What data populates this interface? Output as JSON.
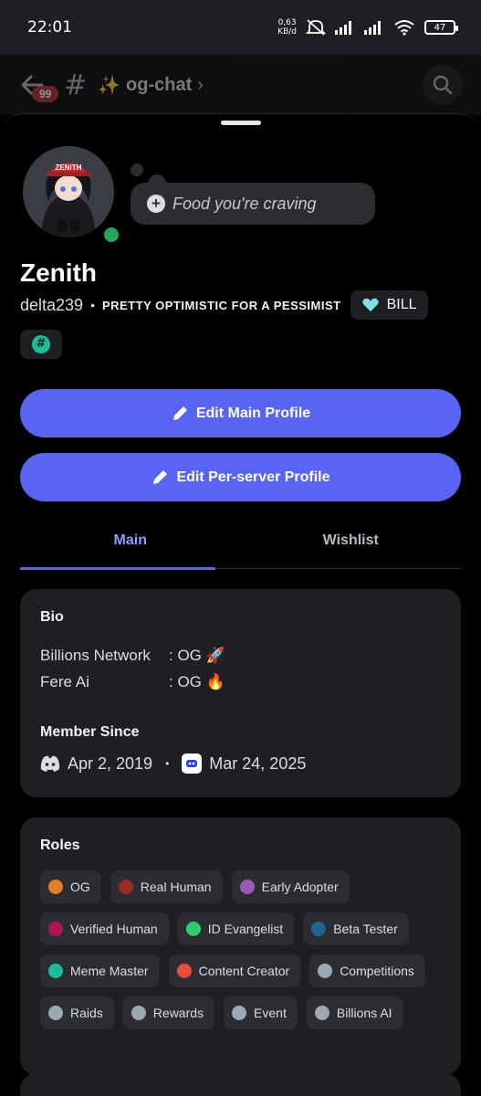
{
  "status_bar": {
    "time": "22:01",
    "net_speed_value": "0,63",
    "net_speed_unit": "KB/d",
    "battery": "47"
  },
  "channel_header": {
    "unread_badge": "99",
    "channel_name": "og-chat"
  },
  "profile": {
    "custom_status_placeholder": "Food you're craving",
    "display_name": "Zenith",
    "username": "delta239",
    "pronouns": "PRETTY OPTIMISTIC FOR A PESSIMIST",
    "clan_tag": "BILL",
    "avatar_cap_text": "ZENITH"
  },
  "buttons": {
    "edit_main": "Edit Main Profile",
    "edit_server": "Edit Per-server Profile"
  },
  "tabs": [
    {
      "label": "Main",
      "active": true
    },
    {
      "label": "Wishlist",
      "active": false
    }
  ],
  "bio": {
    "title": "Bio",
    "lines": [
      {
        "key": "Billions Network",
        "value": ": OG 🚀"
      },
      {
        "key": "Fere Ai",
        "value": ": OG 🔥"
      }
    ]
  },
  "member_since": {
    "title": "Member Since",
    "discord_date": "Apr 2, 2019",
    "server_date": "Mar 24, 2025"
  },
  "roles": {
    "title": "Roles",
    "items": [
      {
        "label": "OG",
        "color": "#e67e22"
      },
      {
        "label": "Real Human",
        "color": "#992d22"
      },
      {
        "label": "Early Adopter",
        "color": "#9b59b6"
      },
      {
        "label": "Verified Human",
        "color": "#ad1457"
      },
      {
        "label": "ID Evangelist",
        "color": "#2ecc71"
      },
      {
        "label": "Beta Tester",
        "color": "#206694"
      },
      {
        "label": "Meme Master",
        "color": "#1abc9c"
      },
      {
        "label": "Content Creator",
        "color": "#e74c3c"
      },
      {
        "label": "Competitions",
        "color": "#99aab5"
      },
      {
        "label": "Raids",
        "color": "#99aab5"
      },
      {
        "label": "Rewards",
        "color": "#99aab5"
      },
      {
        "label": "Event",
        "color": "#99aab5"
      },
      {
        "label": "Billions AI",
        "color": "#99aab5"
      }
    ]
  },
  "colors": {
    "accent": "#5865f2",
    "online": "#23a55a",
    "card": "#1e1f22"
  }
}
